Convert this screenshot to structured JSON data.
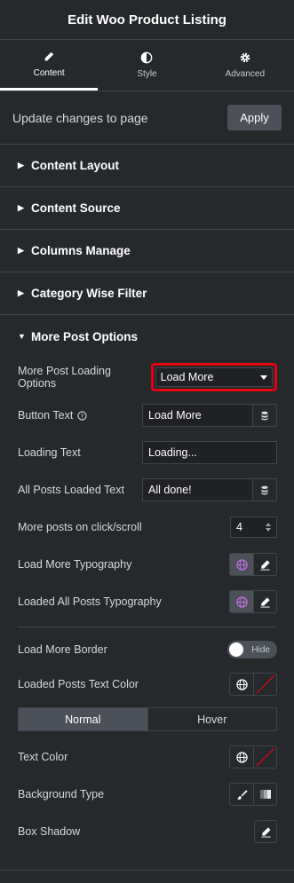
{
  "header": {
    "title": "Edit Woo Product Listing"
  },
  "tabs": [
    {
      "label": "Content",
      "icon": "pencil-icon",
      "active": true
    },
    {
      "label": "Style",
      "icon": "half-circle-icon",
      "active": false
    },
    {
      "label": "Advanced",
      "icon": "gear-icon",
      "active": false
    }
  ],
  "update": {
    "text": "Update changes to page",
    "apply_label": "Apply"
  },
  "sections": [
    {
      "title": "Content Layout"
    },
    {
      "title": "Content Source"
    },
    {
      "title": "Columns Manage"
    },
    {
      "title": "Category Wise Filter"
    },
    {
      "title": "More Post Options"
    }
  ],
  "more_post": {
    "loading_options": {
      "label": "More Post Loading Options",
      "value": "Load More"
    },
    "button_text": {
      "label": "Button Text",
      "value": "Load More"
    },
    "loading_text": {
      "label": "Loading Text",
      "value": "Loading..."
    },
    "all_loaded": {
      "label": "All Posts Loaded Text",
      "value": "All done!"
    },
    "posts_click": {
      "label": "More posts on click/scroll",
      "value": "4"
    },
    "lm_typo": {
      "label": "Load More Typography"
    },
    "la_typo": {
      "label": "Loaded All Posts Typography"
    },
    "lm_border": {
      "label": "Load More Border",
      "toggle": "Hide"
    },
    "lp_text_color": {
      "label": "Loaded Posts Text Color"
    },
    "state_tabs": [
      "Normal",
      "Hover"
    ],
    "text_color": {
      "label": "Text Color"
    },
    "bg_type": {
      "label": "Background Type"
    },
    "box_shadow": {
      "label": "Box Shadow"
    }
  },
  "colors": {
    "accent_red": "#e3000f",
    "panel": "#26292c",
    "typo_purple": "#c36ee0"
  }
}
